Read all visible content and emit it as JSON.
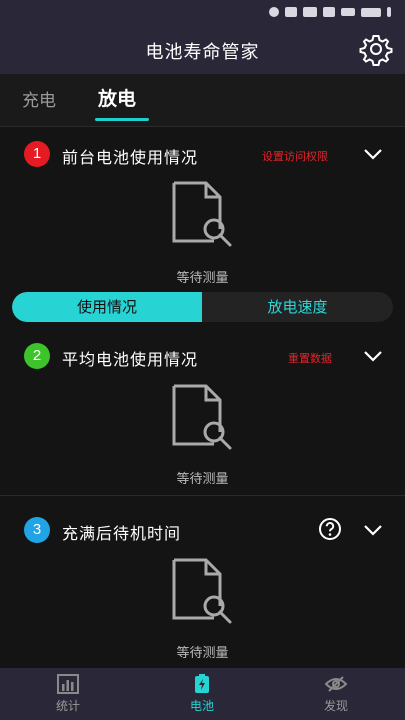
{
  "app": {
    "title": "电池寿命管家"
  },
  "tabs": [
    {
      "label": "充电"
    },
    {
      "label": "放电"
    }
  ],
  "sections": [
    {
      "number": "1",
      "title": "前台电池使用情况",
      "link": "设置访问权限",
      "status": "等待测量",
      "color": "#e51b23"
    },
    {
      "number": "2",
      "title": "平均电池使用情况",
      "link": "重置数据",
      "status": "等待测量",
      "color": "#3cc42a"
    },
    {
      "number": "3",
      "title": "充满后待机时间",
      "status": "等待测量",
      "color": "#20a4e6"
    }
  ],
  "segment": {
    "active": "使用情况",
    "inactive": "放电速度"
  },
  "nav": [
    {
      "label": "统计"
    },
    {
      "label": "电池"
    },
    {
      "label": "发现"
    }
  ],
  "colors": {
    "accent": "#27d3d3",
    "header_bg": "#2a2838",
    "link_red": "#e3242b"
  }
}
